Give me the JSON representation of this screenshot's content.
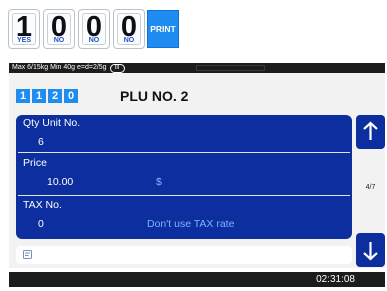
{
  "keypad": [
    {
      "digit": "1",
      "sub": "YES"
    },
    {
      "digit": "0",
      "sub": "NO"
    },
    {
      "digit": "0",
      "sub": "NO"
    },
    {
      "digit": "0",
      "sub": "NO"
    }
  ],
  "print_label": "PRINT",
  "status_bar": {
    "spec": "Max 6/15kg Min 40g e=d=2/5g",
    "class_badge": "III"
  },
  "plu_digits": [
    "1",
    "1",
    "2",
    "0"
  ],
  "plu_title": "PLU NO. 2",
  "fields": [
    {
      "label": "Qty Unit No.",
      "value": "6",
      "note": ""
    },
    {
      "label": "Price",
      "value": "10.00",
      "unit": "$"
    },
    {
      "label": "TAX No.",
      "value": "0",
      "note": "Don't use TAX rate"
    }
  ],
  "pager": "4/7",
  "clock": "02:31:08",
  "colors": {
    "accent": "#1e8cf0",
    "panel": "#0d2e9e",
    "note": "#7ab6ff",
    "bar": "#1c1c1c"
  },
  "icons": {
    "up": "arrow-up-icon",
    "down": "arrow-down-icon",
    "memo": "memo-icon"
  }
}
